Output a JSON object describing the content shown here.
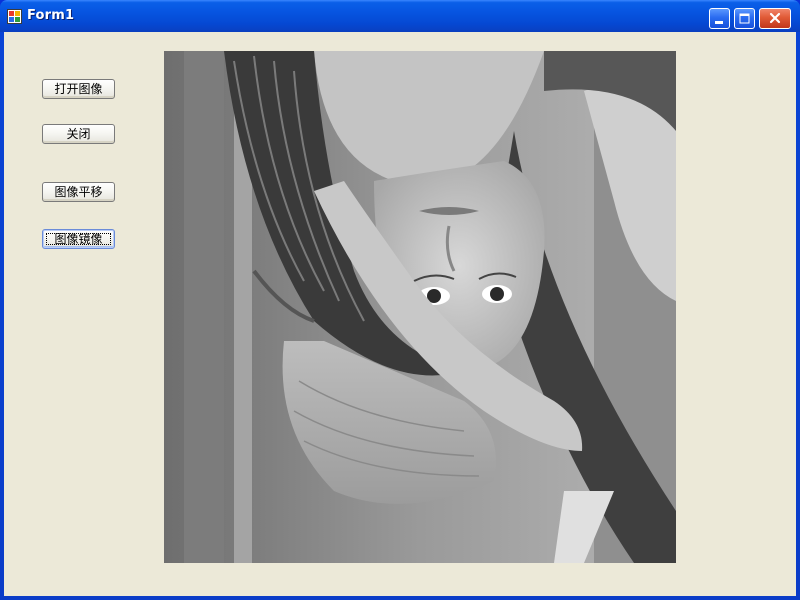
{
  "window": {
    "title": "Form1",
    "controls": {
      "minimize": "minimize",
      "maximize": "maximize",
      "close": "close"
    }
  },
  "buttons": {
    "open_image": "打开图像",
    "close": "关闭",
    "translate_image": "图像平移",
    "mirror_image": "图像镜像"
  },
  "picture_box": {
    "content": "grayscale portrait photograph, vertically flipped (upside down)"
  },
  "colors": {
    "titlebar": "#0548d2",
    "client_background": "#ece9d8",
    "close_button": "#e05a36"
  }
}
